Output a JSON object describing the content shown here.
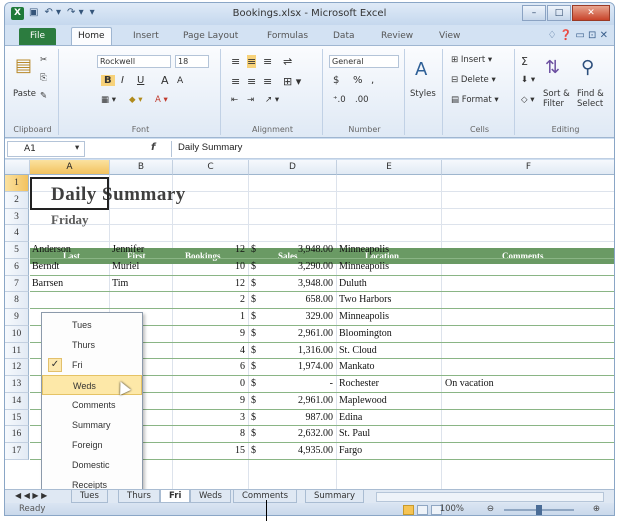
{
  "window": {
    "title": "Bookings.xlsx - Microsoft Excel",
    "minimize": "–",
    "maximize": "□",
    "close": "✕"
  },
  "qat": {
    "save": "▣",
    "undo": "↶ ▾",
    "redo": "↷ ▾",
    "more": "▾"
  },
  "ribbon_tabs": {
    "file": "File",
    "items": [
      "Home",
      "Insert",
      "Page Layout",
      "Formulas",
      "Data",
      "Review",
      "View"
    ],
    "active": "Home",
    "right_icons": "♢ ❓ ▭ ⊡ ✕"
  },
  "ribbon": {
    "clipboard": {
      "label": "Clipboard",
      "paste": "Paste"
    },
    "font": {
      "label": "Font",
      "name": "Rockwell",
      "size": "18",
      "bold": "B",
      "italic": "I",
      "underline": "U",
      "grow": "A",
      "shrink": "A"
    },
    "alignment": {
      "label": "Alignment"
    },
    "number": {
      "label": "Number",
      "format": "General",
      "currency": "$",
      "percent": "%",
      "comma": ","
    },
    "styles": {
      "label": "Styles"
    },
    "cells": {
      "label": "Cells",
      "insert": "Insert",
      "delete": "Delete",
      "format": "Format"
    },
    "editing": {
      "label": "Editing",
      "sort": "Sort &\nFilter",
      "find": "Find &\nSelect",
      "sigma": "Σ"
    }
  },
  "formula_bar": {
    "name_box": "A1",
    "fx": "f",
    "content": "Daily Summary"
  },
  "columns": [
    "A",
    "B",
    "C",
    "D",
    "E",
    "F"
  ],
  "rows": [
    "1",
    "2",
    "3",
    "4",
    "5",
    "6",
    "7",
    "8",
    "9",
    "10",
    "11",
    "12",
    "13",
    "14",
    "15",
    "16",
    "17"
  ],
  "sheet": {
    "title": "Daily Summary",
    "subtitle": "Friday",
    "headers": [
      "Last",
      "First",
      "Bookings",
      "Sales",
      "Location",
      "Comments"
    ],
    "records": [
      {
        "last": "Anderson",
        "first": "Jennifer",
        "bookings": "12",
        "cur": "$",
        "sales": "3,948.00",
        "location": "Minneapolis",
        "comments": ""
      },
      {
        "last": "Berndt",
        "first": "Muriel",
        "bookings": "10",
        "cur": "$",
        "sales": "3,290.00",
        "location": "Minneapolis",
        "comments": ""
      },
      {
        "last": "Barrsen",
        "first": "Tim",
        "bookings": "12",
        "cur": "$",
        "sales": "3,948.00",
        "location": "Duluth",
        "comments": ""
      },
      {
        "last": "",
        "first": "",
        "bookings": "2",
        "cur": "$",
        "sales": "658.00",
        "location": "Two Harbors",
        "comments": ""
      },
      {
        "last": "",
        "first": "",
        "bookings": "1",
        "cur": "$",
        "sales": "329.00",
        "location": "Minneapolis",
        "comments": ""
      },
      {
        "last": "",
        "first": "",
        "bookings": "9",
        "cur": "$",
        "sales": "2,961.00",
        "location": "Bloomington",
        "comments": ""
      },
      {
        "last": "",
        "first": "",
        "bookings": "4",
        "cur": "$",
        "sales": "1,316.00",
        "location": "St. Cloud",
        "comments": ""
      },
      {
        "last": "",
        "first": "",
        "bookings": "6",
        "cur": "$",
        "sales": "1,974.00",
        "location": "Mankato",
        "comments": ""
      },
      {
        "last": "",
        "first": "",
        "bookings": "0",
        "cur": "$",
        "sales": "-",
        "location": "Rochester",
        "comments": "On vacation"
      },
      {
        "last": "",
        "first": "e",
        "bookings": "9",
        "cur": "$",
        "sales": "2,961.00",
        "location": "Maplewood",
        "comments": ""
      },
      {
        "last": "",
        "first": "",
        "bookings": "3",
        "cur": "$",
        "sales": "987.00",
        "location": "Edina",
        "comments": ""
      },
      {
        "last": "",
        "first": "e",
        "bookings": "8",
        "cur": "$",
        "sales": "2,632.00",
        "location": "St. Paul",
        "comments": ""
      },
      {
        "last": "",
        "first": "",
        "bookings": "15",
        "cur": "$",
        "sales": "4,935.00",
        "location": "Fargo",
        "comments": ""
      }
    ]
  },
  "context_menu": {
    "items": [
      "Tues",
      "Thurs",
      "Fri",
      "Weds",
      "Comments",
      "Summary",
      "Foreign",
      "Domestic",
      "Receipts"
    ],
    "checked": "Fri",
    "highlighted": "Weds",
    "check_mark": "✓"
  },
  "sheet_tabs": {
    "nav": "◀ ◀ ▶ ▶",
    "items": [
      "Tues",
      "Thurs",
      "Fri",
      "Weds",
      "Comments",
      "Summary"
    ],
    "active": "Fri"
  },
  "status_bar": {
    "ready": "Ready",
    "zoom": "100%",
    "minus": "⊖",
    "plus": "⊕"
  }
}
